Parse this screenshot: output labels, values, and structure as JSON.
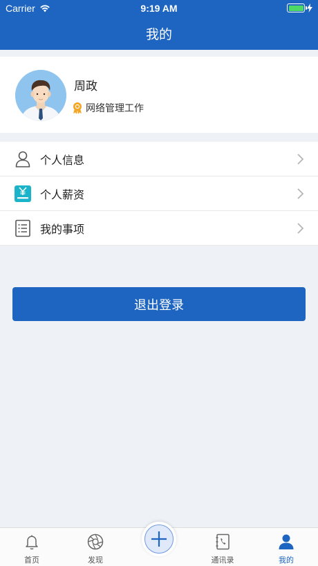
{
  "statusbar": {
    "carrier": "Carrier",
    "time": "9:19 AM"
  },
  "navbar": {
    "title": "我的"
  },
  "profile": {
    "name": "周政",
    "role": "网络管理工作"
  },
  "menu": {
    "items": [
      {
        "label": "个人信息",
        "icon": "person-icon"
      },
      {
        "label": "个人薪资",
        "icon": "salary-icon"
      },
      {
        "label": "我的事项",
        "icon": "list-icon"
      }
    ]
  },
  "logout": {
    "label": "退出登录"
  },
  "tabbar": {
    "items": [
      {
        "label": "首页",
        "icon": "bell-icon"
      },
      {
        "label": "发现",
        "icon": "aperture-icon"
      },
      {
        "label": "",
        "icon": "plus-icon"
      },
      {
        "label": "通讯录",
        "icon": "contacts-icon"
      },
      {
        "label": "我的",
        "icon": "user-icon"
      }
    ]
  },
  "colors": {
    "accent": "#1d65c1",
    "background": "#eef2f6",
    "battery": "#4cd964",
    "badge": "#f5a623",
    "salary_icon": "#1ab3c9"
  }
}
